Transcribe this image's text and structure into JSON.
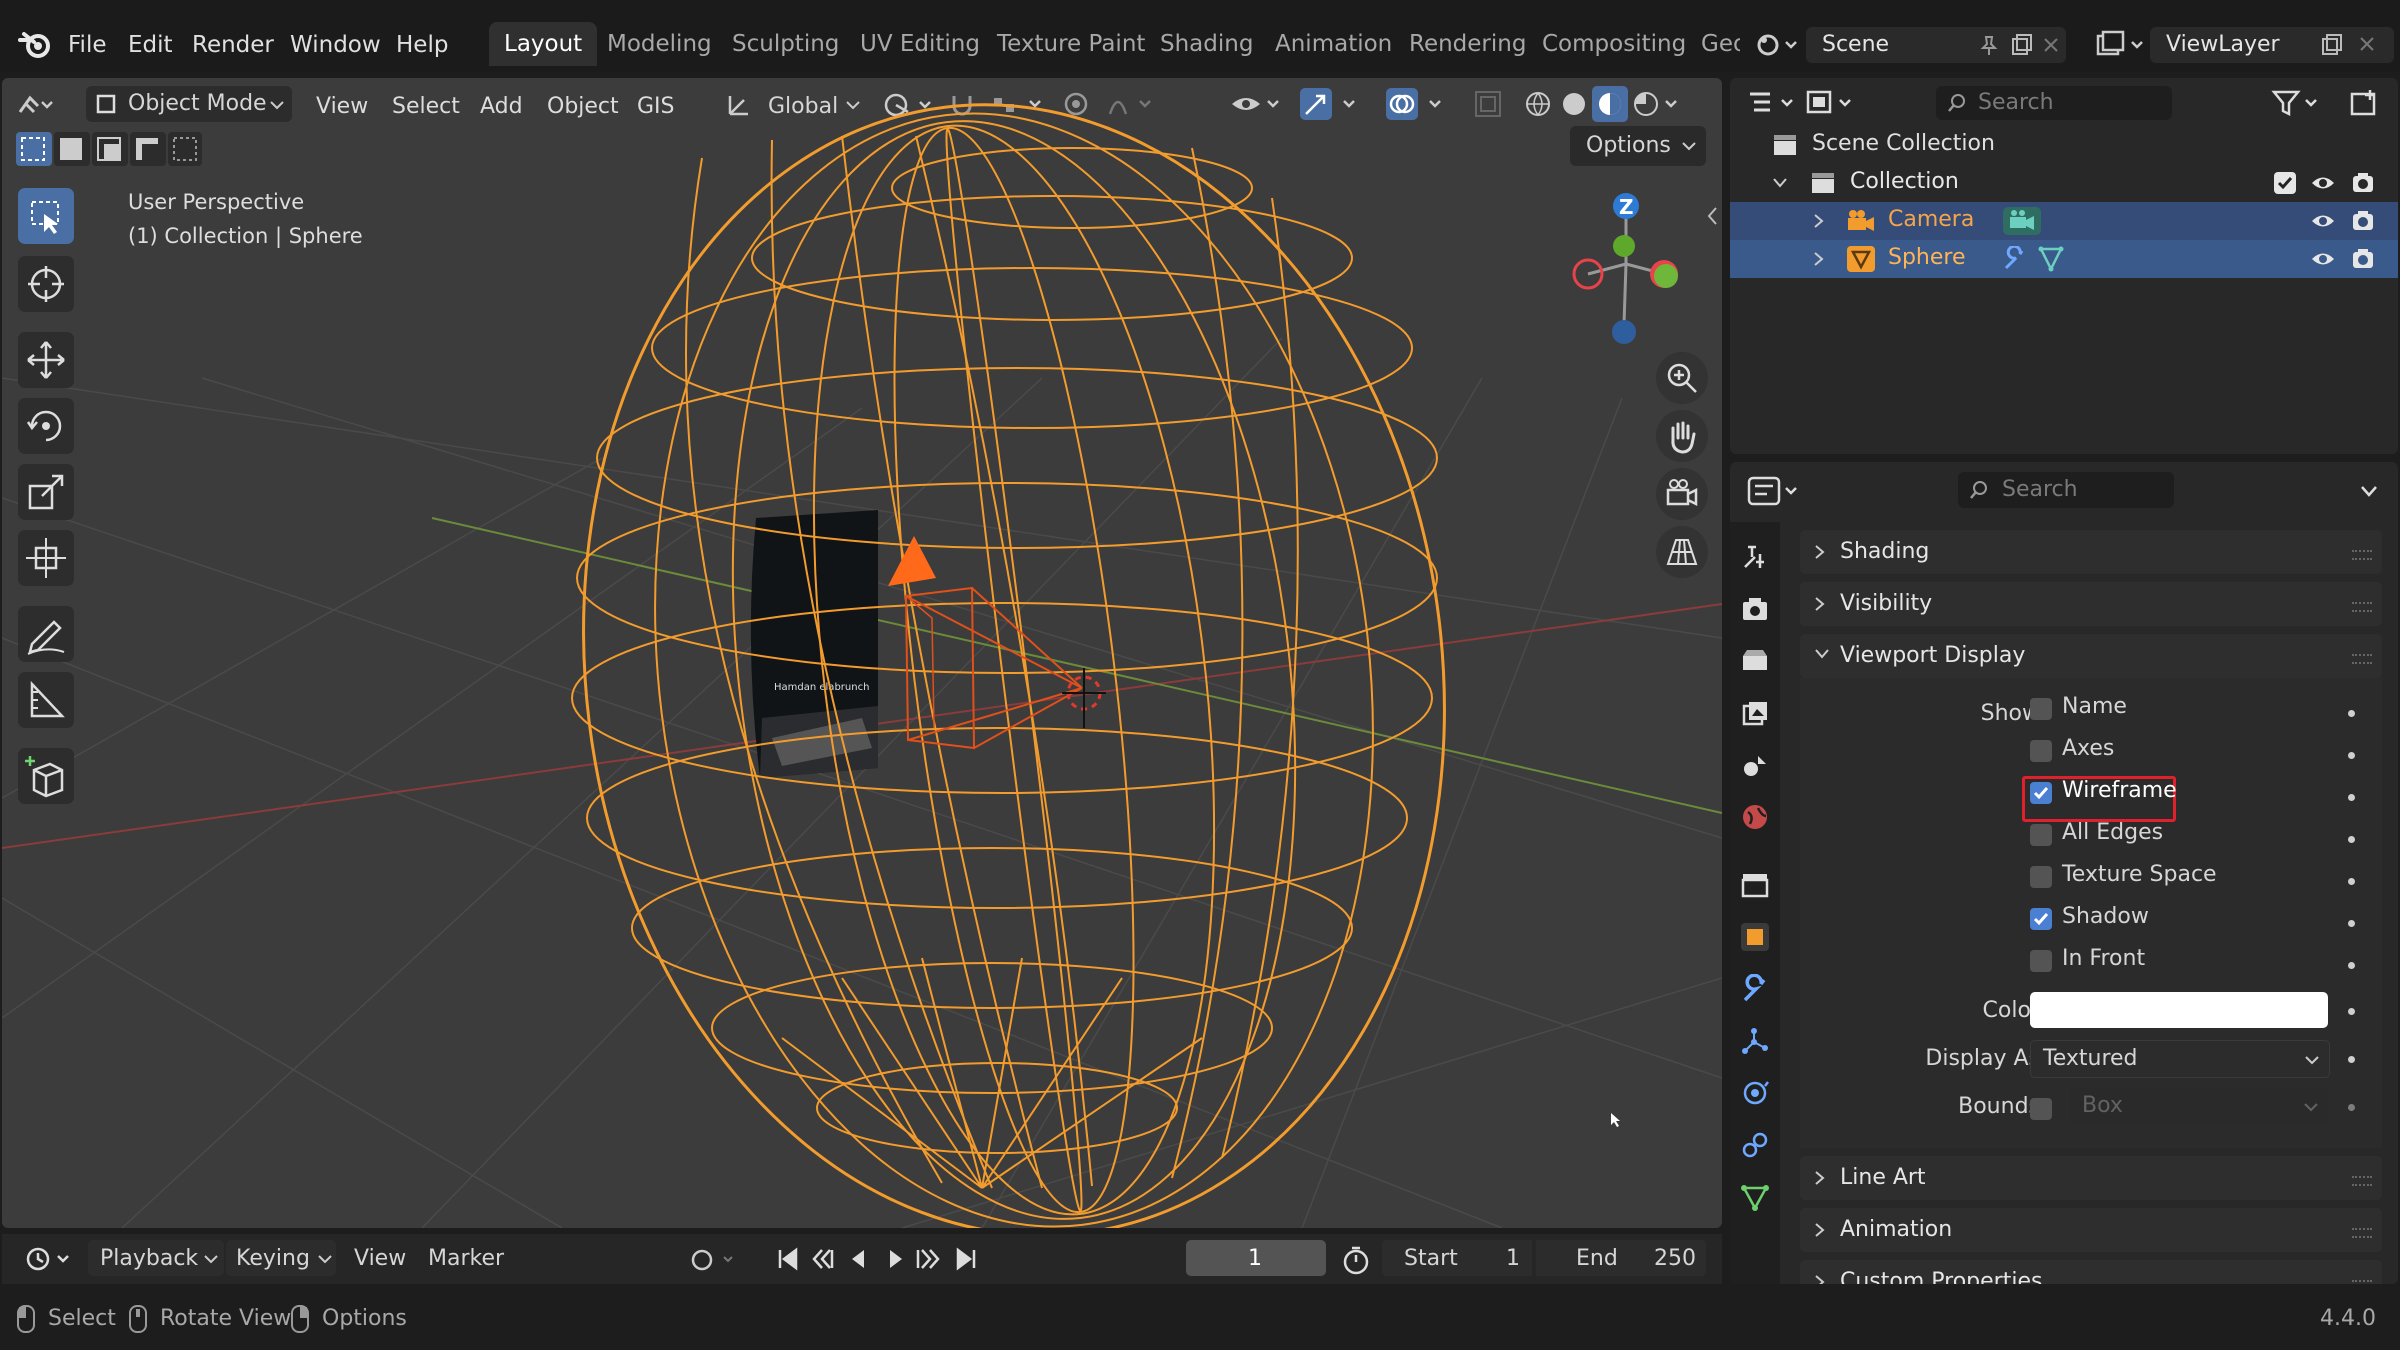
{
  "menu": {
    "file": "File",
    "edit": "Edit",
    "render": "Render",
    "window": "Window",
    "help": "Help"
  },
  "workspaces": [
    "Layout",
    "Modeling",
    "Sculpting",
    "UV Editing",
    "Texture Paint",
    "Shading",
    "Animation",
    "Rendering",
    "Compositing",
    "Geo"
  ],
  "scene": {
    "scene_name": "Scene",
    "view_layer": "ViewLayer"
  },
  "viewport_header": {
    "mode": "Object Mode",
    "view": "View",
    "select": "Select",
    "add": "Add",
    "object": "Object",
    "gis": "GIS",
    "orientation": "Global",
    "options": "Options"
  },
  "viewport_overlay": {
    "perspective": "User Perspective",
    "collection_info": "(1) Collection | Sphere",
    "screen_text": "Hamdan elabrunch"
  },
  "gizmo": {
    "z": "Z"
  },
  "timeline": {
    "playback": "Playback",
    "keying": "Keying",
    "view": "View",
    "marker": "Marker",
    "current_frame": "1",
    "start_label": "Start",
    "start": "1",
    "end_label": "End",
    "end": "250"
  },
  "status": {
    "select": "Select",
    "rotate": "Rotate View",
    "options": "Options",
    "version": "4.4.0"
  },
  "outliner": {
    "search_placeholder": "Search",
    "scene_collection": "Scene Collection",
    "collection": "Collection",
    "camera": "Camera",
    "sphere": "Sphere"
  },
  "properties": {
    "search_placeholder": "Search",
    "panels": {
      "shading": "Shading",
      "visibility": "Visibility",
      "viewport_display": "Viewport Display",
      "line_art": "Line Art",
      "animation": "Animation",
      "custom_properties": "Custom Properties"
    },
    "show_label": "Show",
    "show_options": [
      {
        "label": "Name",
        "checked": false
      },
      {
        "label": "Axes",
        "checked": false
      },
      {
        "label": "Wireframe",
        "checked": true
      },
      {
        "label": "All Edges",
        "checked": false
      },
      {
        "label": "Texture Space",
        "checked": false
      },
      {
        "label": "Shadow",
        "checked": true
      },
      {
        "label": "In Front",
        "checked": false
      }
    ],
    "color_label": "Color",
    "color_value": "#ffffff",
    "display_as_label": "Display As",
    "display_as_value": "Textured",
    "bounds_label": "Bounds",
    "bounds_value": "Box"
  },
  "colors": {
    "accent": "#4a7fd1",
    "selection": "#f39c2e",
    "highlight": "#e0202a",
    "camera_name": "#f5a54a"
  }
}
